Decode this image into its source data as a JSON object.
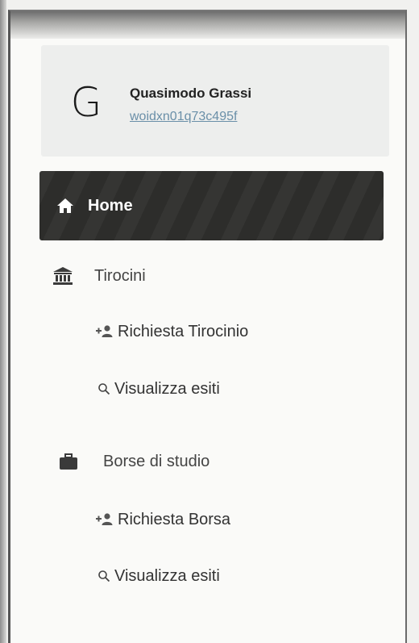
{
  "user": {
    "avatar_letter": "G",
    "name": "Quasimodo Grassi",
    "id": "woidxn01q73c495f"
  },
  "nav": {
    "home_label": "Home",
    "sections": [
      {
        "label": "Tirocini",
        "icon": "bank-icon",
        "items": [
          {
            "label": "Richiesta Tirocinio",
            "icon": "user-plus-icon"
          },
          {
            "label": "Visualizza esiti",
            "icon": "search-icon"
          }
        ]
      },
      {
        "label": "Borse di studio",
        "icon": "briefcase-icon",
        "items": [
          {
            "label": "Richiesta Borsa",
            "icon": "user-plus-icon"
          },
          {
            "label": "Visualizza esiti",
            "icon": "search-icon"
          }
        ]
      }
    ]
  },
  "colors": {
    "active_bg": "#2d2d2b",
    "link": "#6a8fa8",
    "text": "#333333"
  }
}
